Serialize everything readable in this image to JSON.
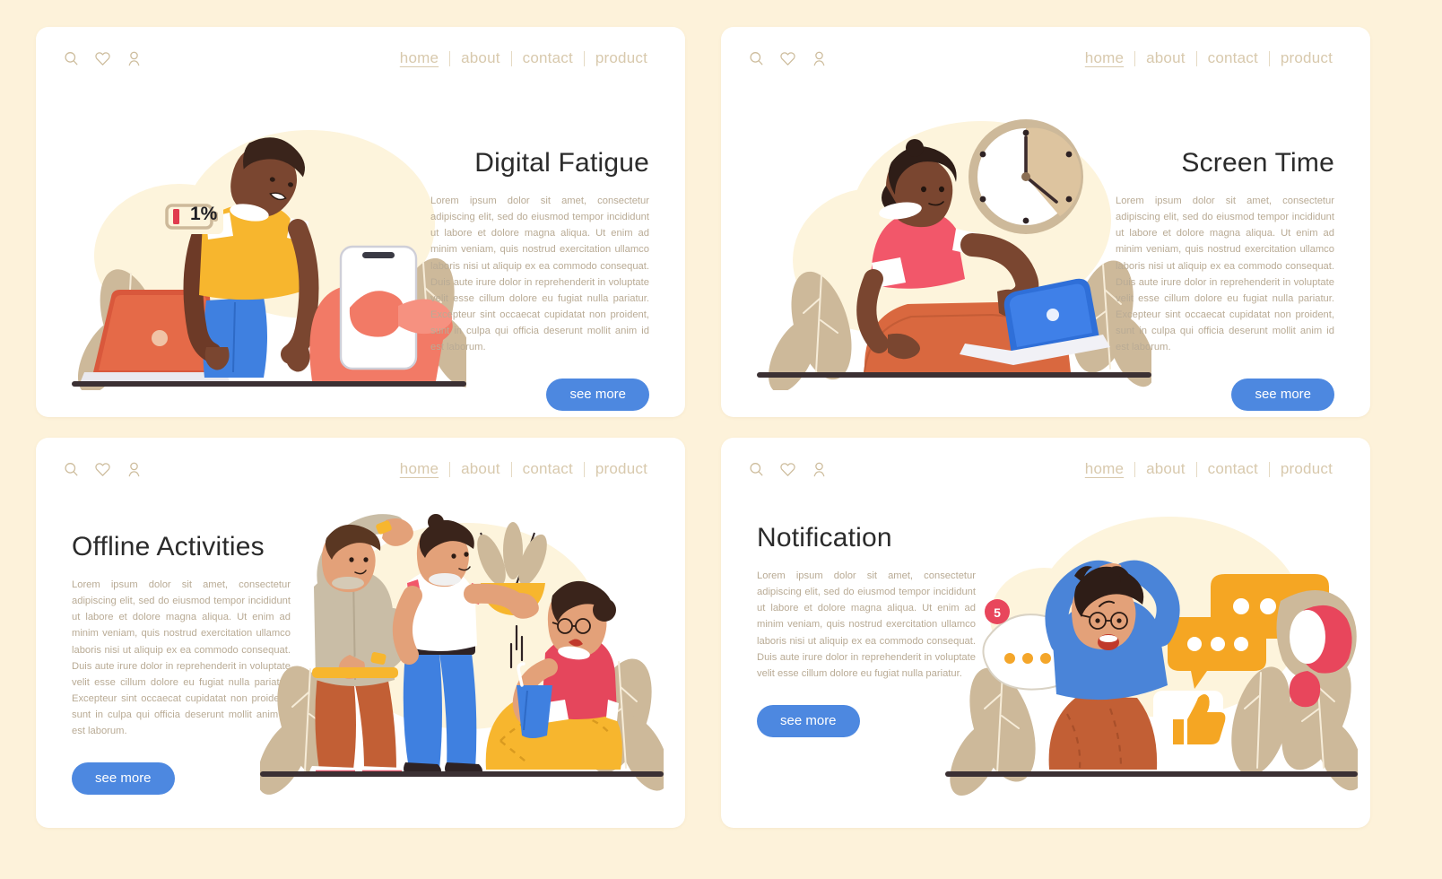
{
  "background_color": "#fdf2da",
  "panel_color": "#ffffff",
  "accent_button_color": "#4d88e0",
  "nav_link_color": "#d8c9ad",
  "nav": {
    "icons": [
      "search-icon",
      "heart-icon",
      "user-icon"
    ],
    "links": [
      {
        "label": "home",
        "active": true
      },
      {
        "label": "about",
        "active": false
      },
      {
        "label": "contact",
        "active": false
      },
      {
        "label": "product",
        "active": false
      }
    ]
  },
  "lorem_full": "Lorem ipsum dolor sit amet, consectetur adipiscing elit, sed do eiusmod tempor incididunt ut labore et dolore magna aliqua. Ut enim ad minim veniam, quis nostrud exercitation ullamco laboris nisi ut aliquip ex ea commodo consequat. Duis aute irure dolor in reprehenderit in voluptate velit esse cillum dolore eu fugiat nulla pariatur. Excepteur sint occaecat cupidatat non proident, sunt in culpa qui officia deserunt mollit anim id est laborum.",
  "lorem_short": "Lorem ipsum dolor sit amet, consectetur adipiscing elit, sed do eiusmod tempor incididunt ut labore et dolore magna aliqua. Ut enim ad minim veniam, quis nostrud exercitation ullamco laboris nisi ut aliquip ex ea commodo consequat. Duis aute irure dolor in reprehenderit in voluptate velit esse cillum dolore eu fugiat nulla pariatur.",
  "panels": [
    {
      "id": "digital-fatigue",
      "title": "Digital Fatigue",
      "button_label": "see more",
      "text_align": "right",
      "illustration": "tired-man-with-phone-and-laptop",
      "badge_label": "1%"
    },
    {
      "id": "screen-time",
      "title": "Screen Time",
      "button_label": "see more",
      "text_align": "right",
      "illustration": "woman-on-laptop-with-clock"
    },
    {
      "id": "offline-activities",
      "title": "Offline Activities",
      "button_label": "see more",
      "text_align": "left",
      "illustration": "three-people-stretching-plant-drink"
    },
    {
      "id": "notification",
      "title": "Notification",
      "button_label": "see more",
      "text_align": "left",
      "illustration": "stressed-woman-with-notifications",
      "badge_count": "5"
    }
  ]
}
